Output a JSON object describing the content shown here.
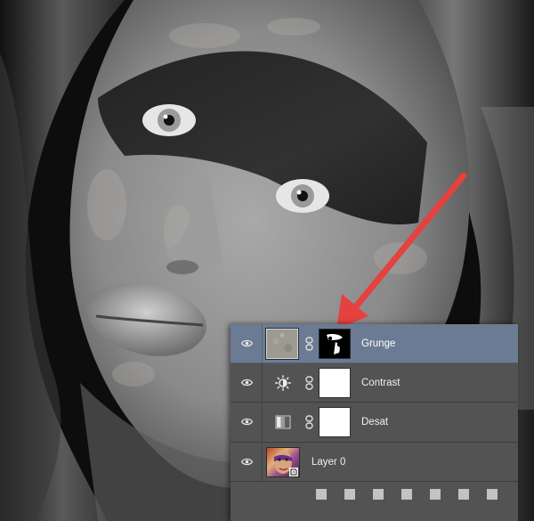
{
  "layers_panel": {
    "layers": [
      {
        "name": "Grunge",
        "kind": "pixel-with-mask",
        "selected": true,
        "visible": true
      },
      {
        "name": "Contrast",
        "kind": "brightness-contrast-adjustment",
        "selected": false,
        "visible": true
      },
      {
        "name": "Desat",
        "kind": "black-white-adjustment",
        "selected": false,
        "visible": true
      },
      {
        "name": "Layer 0",
        "kind": "smart-object",
        "selected": false,
        "visible": true
      }
    ],
    "footer_icons": [
      "link-layers-icon",
      "fx-icon",
      "add-mask-icon",
      "adjustment-icon",
      "folder-icon",
      "new-layer-icon",
      "trash-icon"
    ]
  },
  "annotation": {
    "color": "#e5413f",
    "points_to": "Grunge layer mask thumbnail"
  },
  "colors": {
    "panel_bg": "#535353",
    "selected_row": "#6b7b93"
  }
}
